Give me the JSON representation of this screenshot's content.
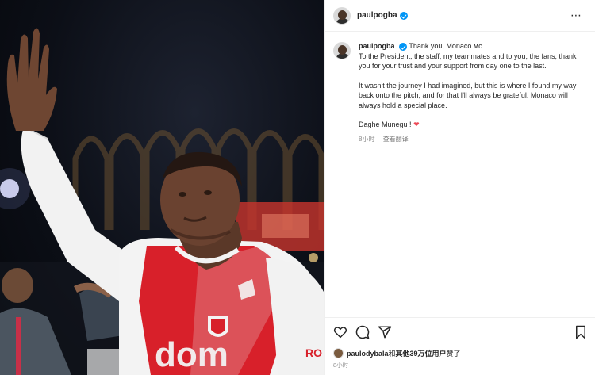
{
  "post": {
    "username": "paulpogba",
    "caption": {
      "username": "paulpogba",
      "line1": "Thank you, Monaco мс",
      "para1_rest": "To the President, the staff, my teammates and to you, the fans, thank you for your trust and your support from day one to the last.",
      "para2": "It wasn't the journey I had imagined, but this is where I found my way back onto the pitch, and for that I'll always be grateful. Monaco will always hold a special place.",
      "para3": "Daghe Munegu !",
      "heart": "❤",
      "time": "8小时",
      "translate": "查看翻译"
    },
    "likes": {
      "user": "paulodybala",
      "rest_prefix": "和",
      "rest_bold": "其他39万位用户",
      "rest_suffix": "赞了"
    },
    "time_ago": "8小时",
    "more_icon": "⋯"
  },
  "icons": {
    "like": "heart-icon",
    "comment": "comment-icon",
    "share": "share-icon",
    "save": "bookmark-icon",
    "verified": "verified-badge-icon"
  },
  "colors": {
    "verified": "#0095f6",
    "heart": "#ed4956",
    "jersey_red": "#d8202a",
    "jersey_white": "#f3f3f3"
  }
}
